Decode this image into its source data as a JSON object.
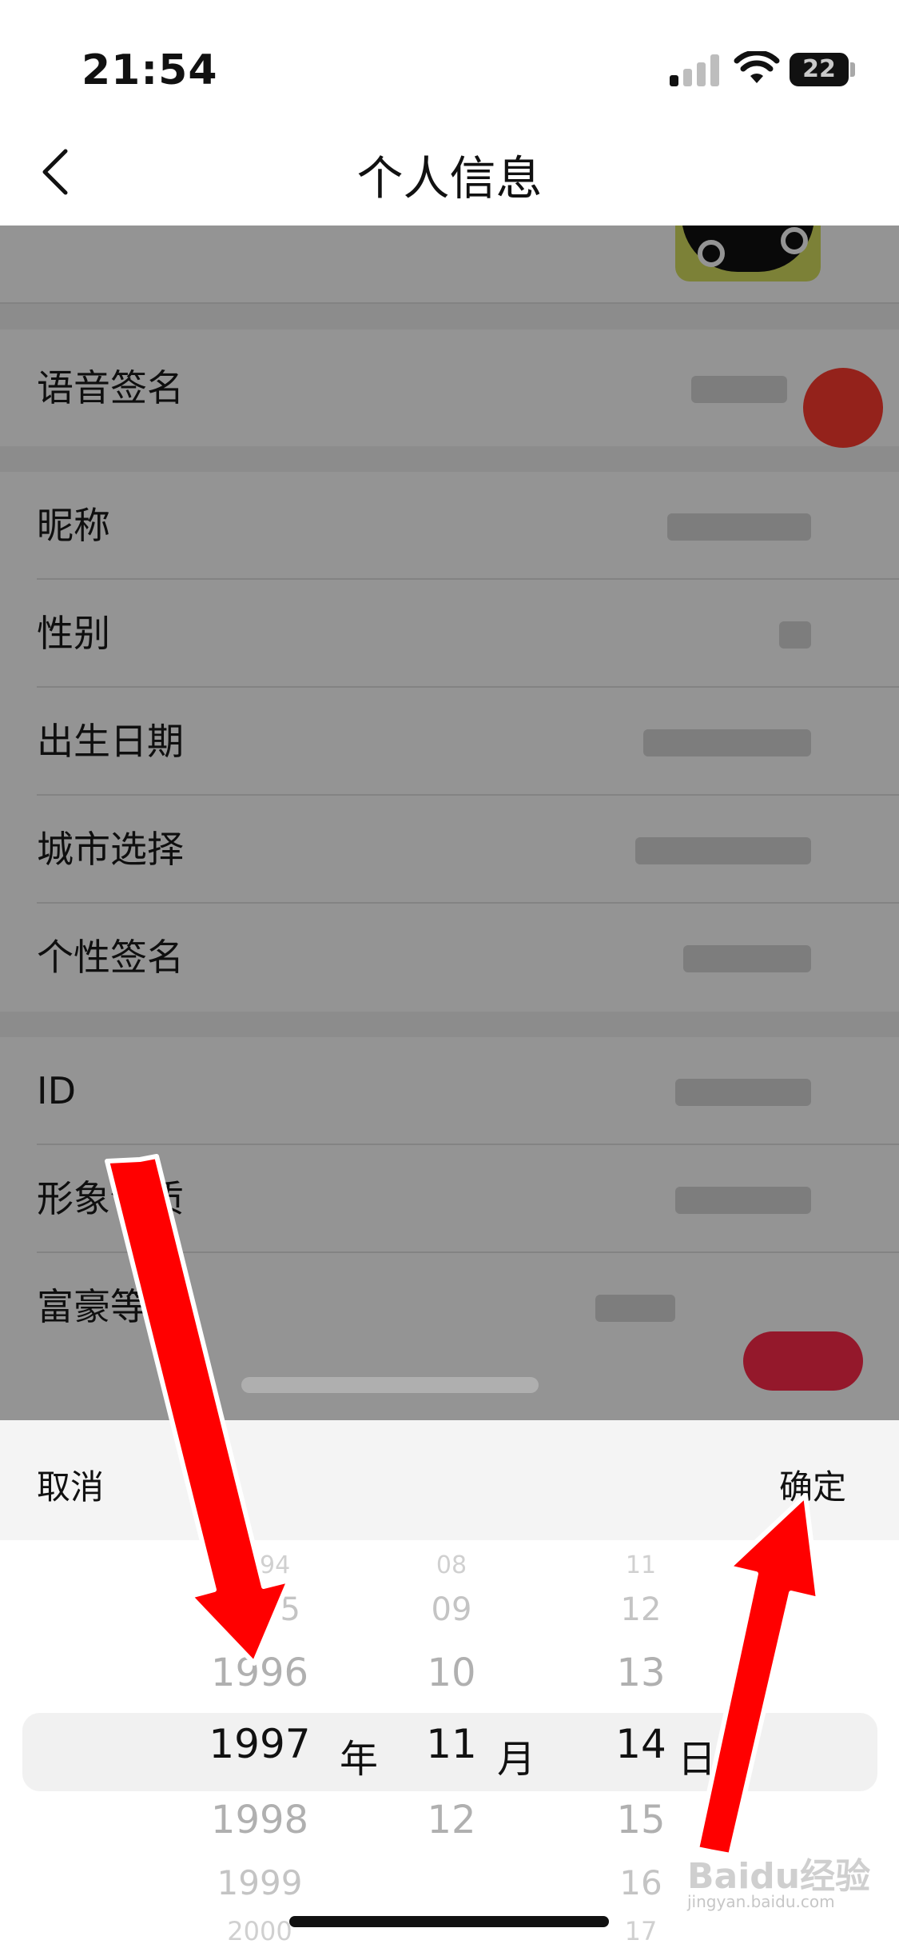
{
  "status_bar": {
    "time": "21:54",
    "battery": "22"
  },
  "header": {
    "title": "个人信息"
  },
  "rows": {
    "voice_signature": "语音签名",
    "nickname": "昵称",
    "gender": "性别",
    "birthday": "出生日期",
    "city": "城市选择",
    "signature": "个性签名",
    "id": "ID",
    "image": "形象气质",
    "wealth_level": "富豪等级"
  },
  "picker": {
    "cancel_label": "取消",
    "confirm_label": "确定",
    "year": {
      "above": [
        "1994",
        "1995",
        "1996"
      ],
      "selected": "1997",
      "below": [
        "1998",
        "1999",
        "2000"
      ],
      "unit": "年"
    },
    "month": {
      "above": [
        "08",
        "09",
        "10"
      ],
      "selected": "11",
      "below": [
        "12"
      ],
      "unit": "月"
    },
    "day": {
      "above": [
        "11",
        "12",
        "13"
      ],
      "selected": "14",
      "below": [
        "15",
        "16",
        "17"
      ],
      "unit": "日"
    }
  },
  "watermark": {
    "brand": "Baidu经验",
    "url": "jingyan.baidu.com"
  },
  "colors": {
    "annotation_arrow": "#ff0000",
    "accent_red": "#ff3b30"
  }
}
